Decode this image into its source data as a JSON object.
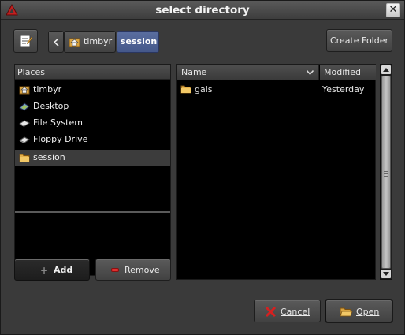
{
  "window": {
    "title": "select directory"
  },
  "toolbar": {
    "create_folder_label": "Create Folder"
  },
  "breadcrumb": {
    "items": [
      "timbyr",
      "session"
    ]
  },
  "places": {
    "header": "Places",
    "items": [
      {
        "label": "timbyr",
        "icon": "home-folder-icon"
      },
      {
        "label": "Desktop",
        "icon": "desktop-icon"
      },
      {
        "label": "File System",
        "icon": "drive-icon"
      },
      {
        "label": "Floppy Drive",
        "icon": "floppy-icon"
      },
      {
        "label": "session",
        "icon": "folder-icon"
      }
    ],
    "add_label": "Add",
    "remove_label": "Remove"
  },
  "files": {
    "columns": {
      "name": "Name",
      "modified": "Modified"
    },
    "rows": [
      {
        "name": "gals",
        "modified": "Yesterday",
        "icon": "folder-icon"
      }
    ]
  },
  "actions": {
    "cancel_label": "Cancel",
    "open_label": "Open"
  },
  "colors": {
    "accent": "#45588a",
    "background": "#3a3a3a",
    "list_background": "#000000"
  }
}
